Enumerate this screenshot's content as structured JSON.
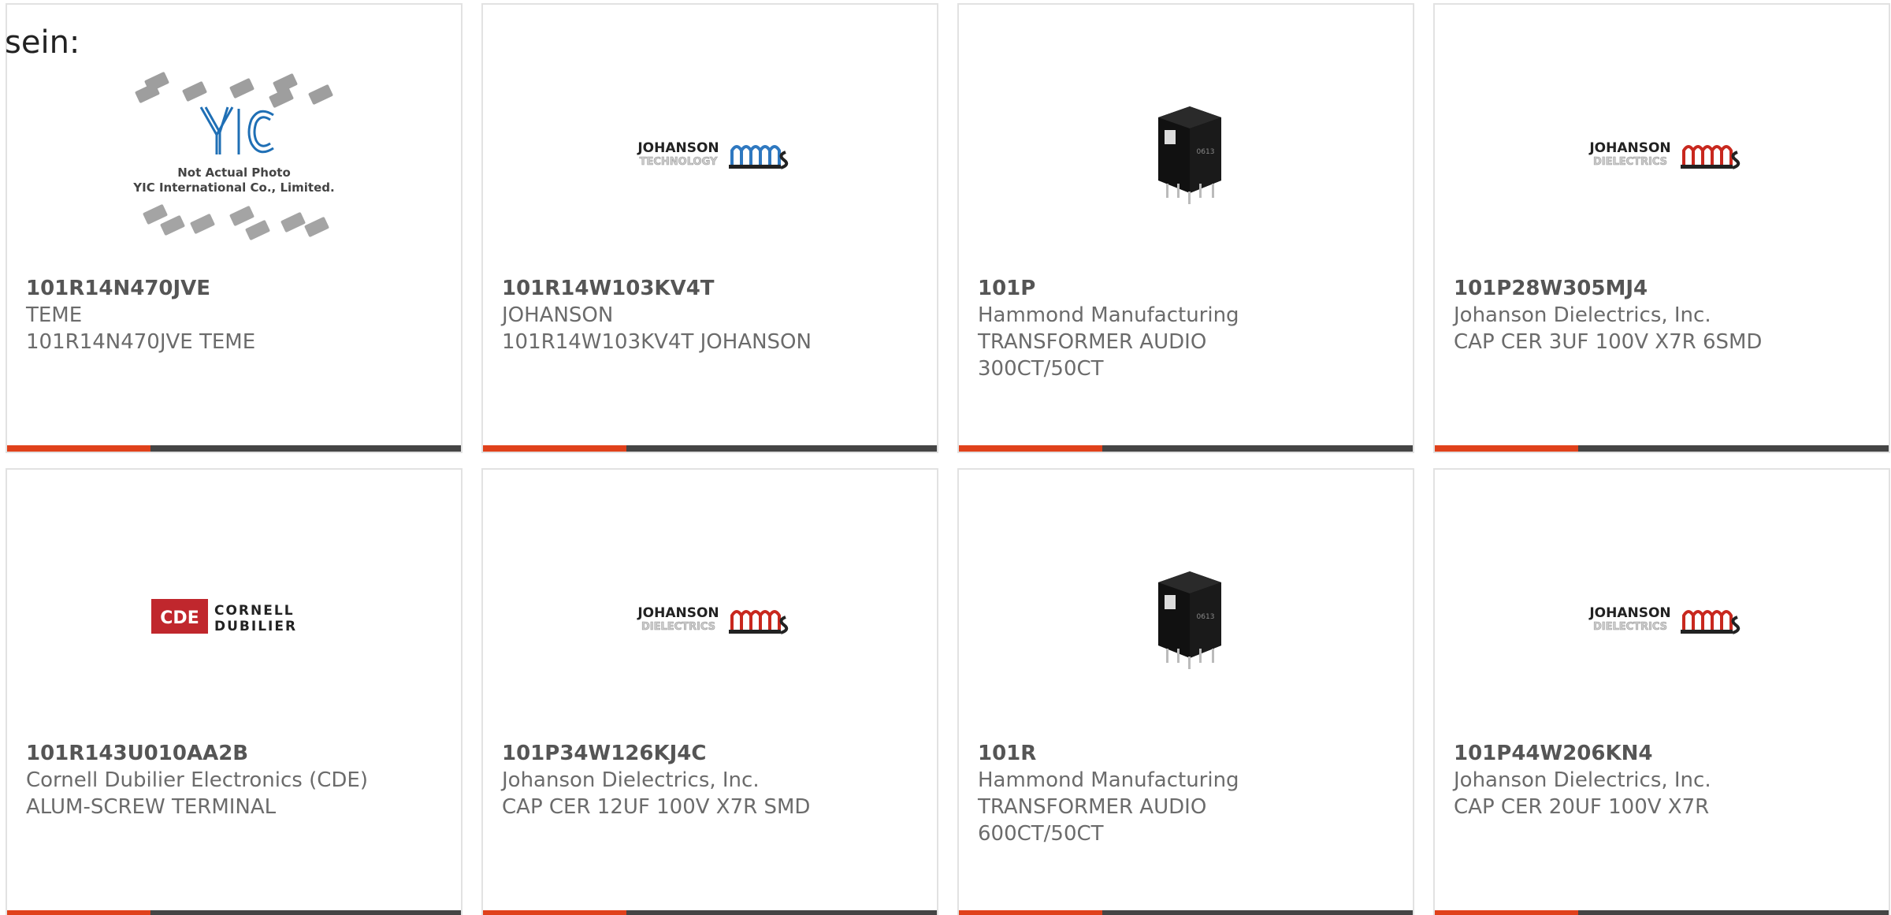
{
  "stray_text": "sein:",
  "products": [
    {
      "part": "101R14N470JVE",
      "lines": [
        "TEME",
        "101R14N470JVE TEME"
      ],
      "image": "yic-placeholder",
      "image_caption_1": "Not Actual Photo",
      "image_caption_2": "YIC International Co., Limited.",
      "logo_text": "YIC"
    },
    {
      "part": "101R14W103KV4T",
      "lines": [
        "JOHANSON",
        "101R14W103KV4T JOHANSON"
      ],
      "image": "johanson-technology-logo",
      "logo_top": "JOHANSON",
      "logo_bottom": "TECHNOLOGY"
    },
    {
      "part": "101P",
      "lines": [
        "Hammond Manufacturing",
        "TRANSFORMER AUDIO",
        "300CT/50CT"
      ],
      "image": "transformer-photo",
      "chip_label": "0613"
    },
    {
      "part": "101P28W305MJ4",
      "lines": [
        "Johanson Dielectrics, Inc.",
        "CAP CER 3UF 100V X7R 6SMD"
      ],
      "image": "johanson-dielectrics-logo",
      "logo_top": "JOHANSON",
      "logo_bottom": "DIELECTRICS"
    },
    {
      "part": "101R143U010AA2B",
      "lines": [
        "Cornell Dubilier Electronics (CDE)",
        "ALUM-SCREW TERMINAL"
      ],
      "image": "cde-logo",
      "logo_badge": "CDE",
      "logo_line1": "CORNELL",
      "logo_line2": "DUBILIER"
    },
    {
      "part": "101P34W126KJ4C",
      "lines": [
        "Johanson Dielectrics, Inc.",
        "CAP CER 12UF 100V X7R SMD"
      ],
      "image": "johanson-dielectrics-logo",
      "logo_top": "JOHANSON",
      "logo_bottom": "DIELECTRICS"
    },
    {
      "part": "101R",
      "lines": [
        "Hammond Manufacturing",
        "TRANSFORMER AUDIO",
        "600CT/50CT"
      ],
      "image": "transformer-photo",
      "chip_label": "0613"
    },
    {
      "part": "101P44W206KN4",
      "lines": [
        "Johanson Dielectrics, Inc.",
        "CAP CER 20UF 100V X7R"
      ],
      "image": "johanson-dielectrics-logo",
      "logo_top": "JOHANSON",
      "logo_bottom": "DIELECTRICS"
    }
  ],
  "colors": {
    "accent": "#e0411b",
    "bar": "#454545",
    "johanson_red": "#c8281e",
    "johanson_blue": "#2e78c0",
    "cde_red": "#c0272d",
    "yic_blue": "#1f6fb5"
  }
}
